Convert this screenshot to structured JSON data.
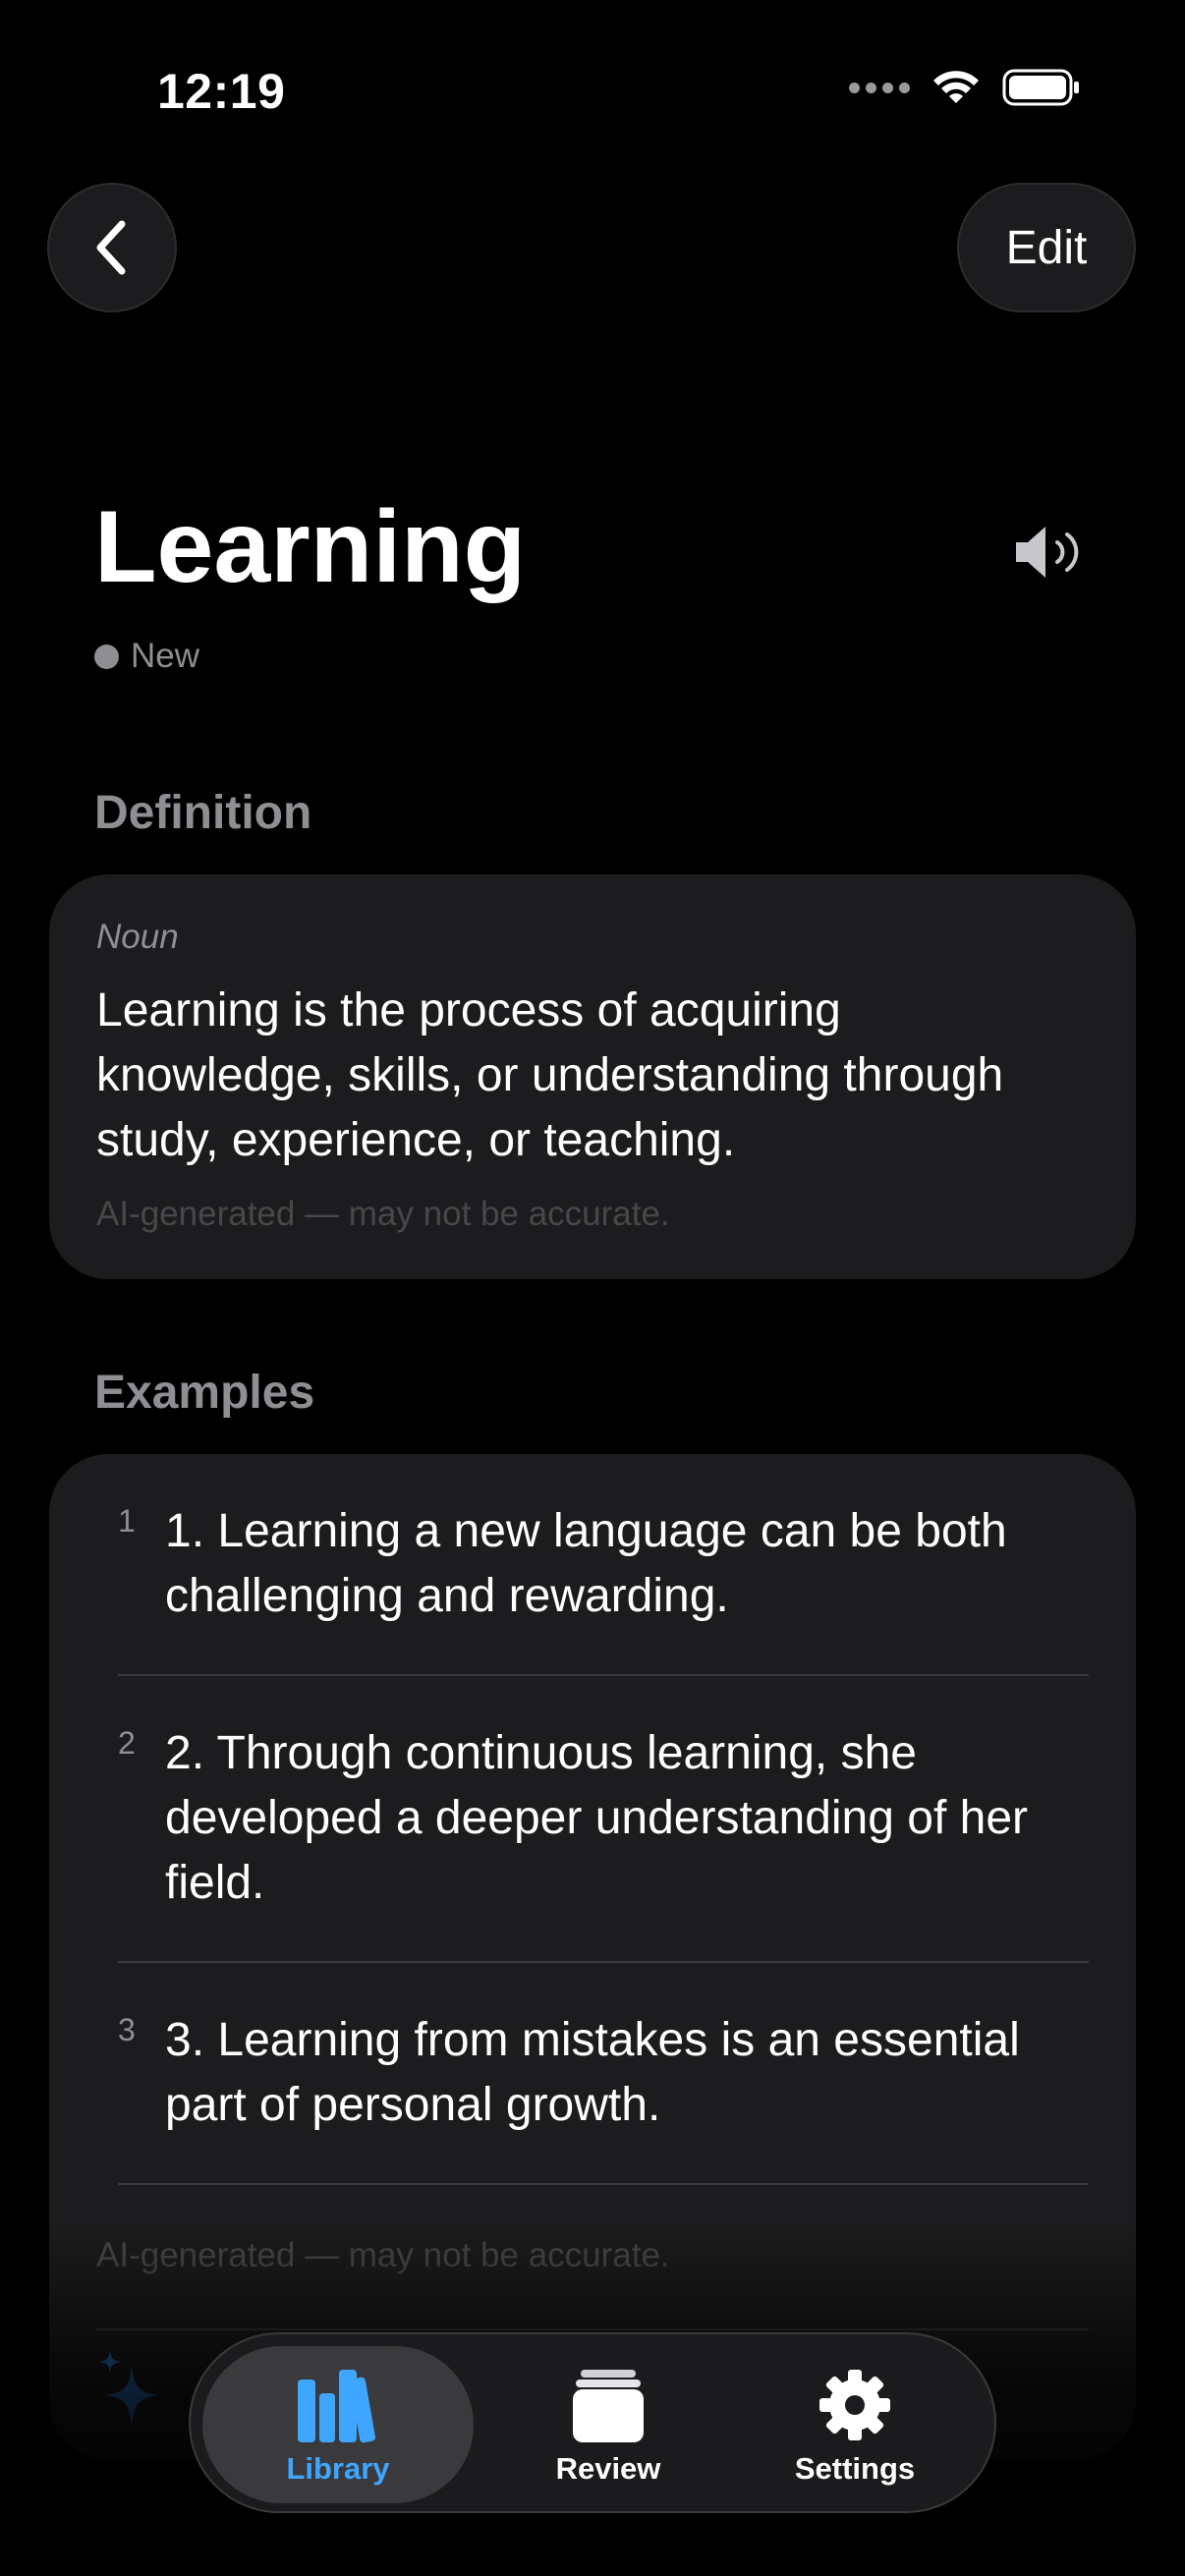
{
  "status_bar": {
    "time": "12:19"
  },
  "nav": {
    "edit_label": "Edit"
  },
  "word": {
    "title": "Learning",
    "status": "New"
  },
  "definition": {
    "section_label": "Definition",
    "part_of_speech": "Noun",
    "text": "Learning is the process of acquiring knowledge, skills, or understanding through study, experience, or teaching.",
    "ai_note": "AI-generated — may not be accurate."
  },
  "examples": {
    "section_label": "Examples",
    "items": [
      {
        "num": "1",
        "text": "1. Learning a new language can be both challenging and rewarding."
      },
      {
        "num": "2",
        "text": "2. Through continuous learning, she developed a deeper understanding of her field."
      },
      {
        "num": "3",
        "text": "3. Learning from mistakes is an essential part of personal growth."
      }
    ],
    "ai_note": "AI-generated — may not be accurate."
  },
  "tab_bar": {
    "tabs": [
      {
        "label": "Library",
        "icon": "books-icon",
        "active": true
      },
      {
        "label": "Review",
        "icon": "cards-stack-icon",
        "active": false
      },
      {
        "label": "Settings",
        "icon": "gear-icon",
        "active": false
      }
    ]
  },
  "colors": {
    "accent": "#3ea6ff",
    "card": "#1c1c1e",
    "secondary_text": "#8e8e93",
    "background": "#000000"
  }
}
